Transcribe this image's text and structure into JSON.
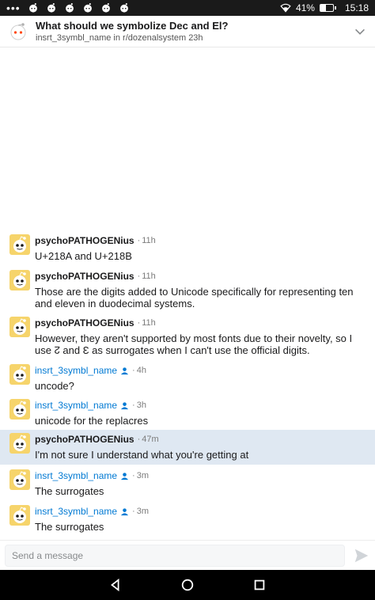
{
  "status_bar": {
    "battery": "41%",
    "time": "15:18",
    "battery_level": 0.41,
    "notification_icons": [
      "more-dots-icon",
      "reddit-icon",
      "reddit-icon",
      "reddit-icon",
      "reddit-icon",
      "reddit-icon",
      "reddit-icon"
    ]
  },
  "header": {
    "title": "What should we symbolize Dec and El?",
    "subtitle": "insrt_3symbl_name in r/dozenalsystem 23h"
  },
  "messages": [
    {
      "user": "psychoPATHOGENius",
      "self": false,
      "time": "11h",
      "text": "U+218A and U+218B",
      "highlight": false
    },
    {
      "user": "psychoPATHOGENius",
      "self": false,
      "time": "11h",
      "text": "Those are the digits added to Unicode specifically for representing ten and eleven in duodecimal systems.",
      "highlight": false
    },
    {
      "user": "psychoPATHOGENius",
      "self": false,
      "time": "11h",
      "text": "However, they aren't supported by most fonts due to their novelty, so I use ↊ and Ɛ as surrogates when I can't use the official digits.",
      "highlight": false
    },
    {
      "user": "insrt_3symbl_name",
      "self": true,
      "time": "4h",
      "text": "uncode?",
      "highlight": false
    },
    {
      "user": "insrt_3symbl_name",
      "self": true,
      "time": "3h",
      "text": "unicode for the replacres",
      "highlight": false
    },
    {
      "user": "psychoPATHOGENius",
      "self": false,
      "time": "47m",
      "text": "I'm not sure I understand what you're getting at",
      "highlight": true
    },
    {
      "user": "insrt_3symbl_name",
      "self": true,
      "time": "3m",
      "text": "The surrogates",
      "highlight": false
    },
    {
      "user": "insrt_3symbl_name",
      "self": true,
      "time": "3m",
      "text": "The surrogates",
      "highlight": false
    }
  ],
  "composer": {
    "placeholder": "Send a message"
  },
  "colors": {
    "self_user": "#0079d3",
    "highlight_bg": "#dfe8f2",
    "avatar_bg": "#f6d46b"
  }
}
